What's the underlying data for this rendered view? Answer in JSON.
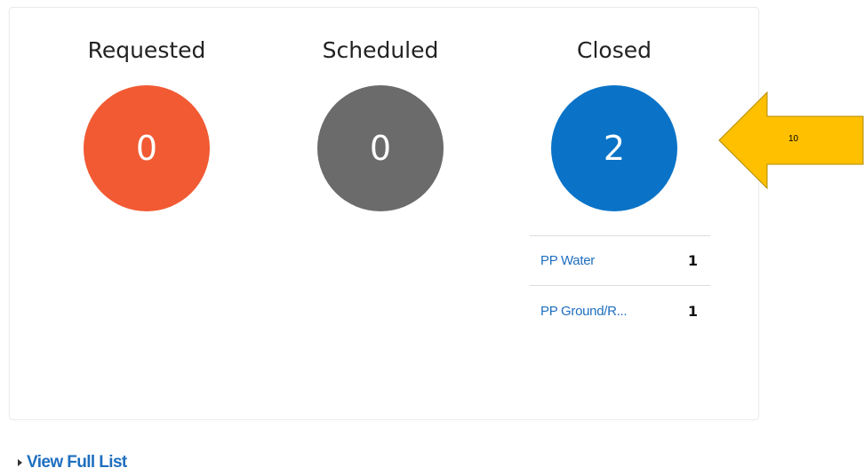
{
  "statuses": [
    {
      "title": "Requested",
      "count": "0",
      "color": "#f15a33"
    },
    {
      "title": "Scheduled",
      "count": "0",
      "color": "#6b6b6b"
    },
    {
      "title": "Closed",
      "count": "2",
      "color": "#0a73c7"
    }
  ],
  "closed_breakdown": [
    {
      "label": "PP Water",
      "count": "1"
    },
    {
      "label": "PP Ground/R...",
      "count": "1"
    }
  ],
  "annotation": {
    "label": "10",
    "color": "#ffc000",
    "border_color": "#b08a00"
  },
  "footer": {
    "view_full_list": "View Full List"
  }
}
